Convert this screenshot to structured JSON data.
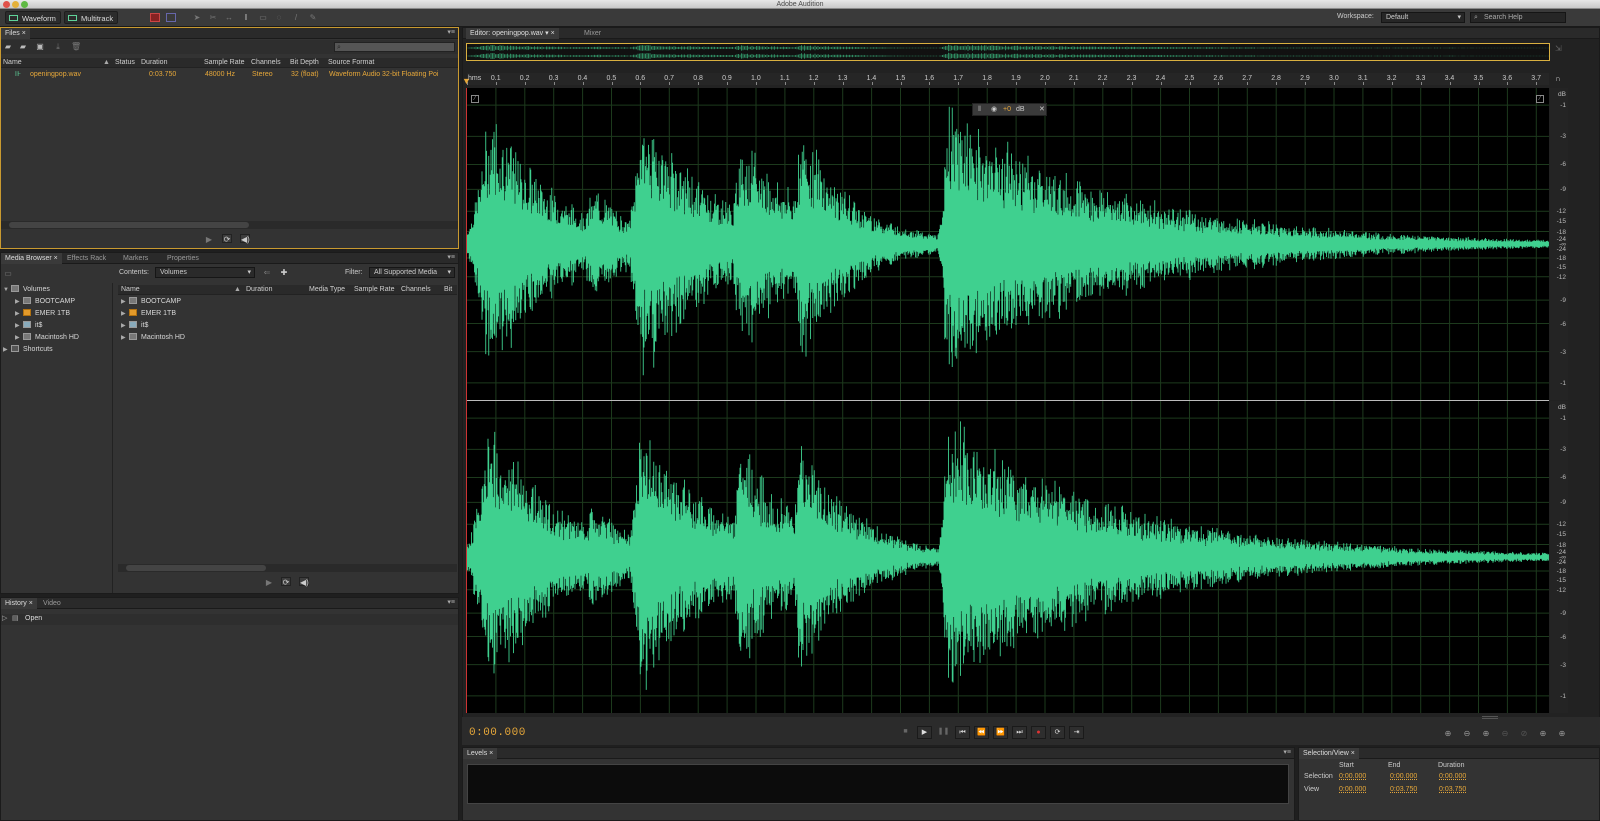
{
  "app": {
    "title": "Adobe Audition"
  },
  "toolbar": {
    "waveform_label": "Waveform",
    "multitrack_label": "Multitrack",
    "workspace_label": "Workspace:",
    "workspace_value": "Default",
    "search_placeholder": "Search Help"
  },
  "files_panel": {
    "tab": "Files",
    "columns": [
      "Name",
      "Status",
      "Duration",
      "Sample Rate",
      "Channels",
      "Bit Depth",
      "Source Format"
    ],
    "rows": [
      {
        "name": "openingpop.wav",
        "status": "",
        "duration": "0:03.750",
        "sample_rate": "48000 Hz",
        "channels": "Stereo",
        "bit_depth": "32 (float)",
        "source_format": "Waveform Audio 32-bit Floating Poi"
      }
    ]
  },
  "media_browser": {
    "tabs": [
      "Media Browser",
      "Effects Rack",
      "Markers",
      "Properties"
    ],
    "contents_label": "Contents:",
    "contents_value": "Volumes",
    "filter_label": "Filter:",
    "filter_value": "All Supported Media",
    "tree": {
      "root": "Volumes",
      "items": [
        "BOOTCAMP",
        "EMER 1TB",
        "it$",
        "Macintosh HD"
      ],
      "shortcuts": "Shortcuts"
    },
    "columns": [
      "Name",
      "Duration",
      "Media Type",
      "Sample Rate",
      "Channels",
      "Bit"
    ],
    "list": [
      "BOOTCAMP",
      "EMER 1TB",
      "it$",
      "Macintosh HD"
    ]
  },
  "history_panel": {
    "tabs": [
      "History",
      "Video"
    ],
    "items": [
      "Open"
    ]
  },
  "editor": {
    "tabs": [
      "Editor: openingpop.wav",
      "Mixer"
    ],
    "ruler": [
      "hms",
      "0.1",
      "0.2",
      "0.3",
      "0.4",
      "0.5",
      "0.6",
      "0.7",
      "0.8",
      "0.9",
      "1.0",
      "1.1",
      "1.2",
      "1.3",
      "1.4",
      "1.5",
      "1.6",
      "1.7",
      "1.8",
      "1.9",
      "2.0",
      "2.1",
      "2.2",
      "2.3",
      "2.4",
      "2.5",
      "2.6",
      "2.7",
      "2.8",
      "2.9",
      "3.0",
      "3.1",
      "3.2",
      "3.3",
      "3.4",
      "3.5",
      "3.6",
      "3.7"
    ],
    "db_scale": [
      "dB",
      "-1",
      "-3",
      "-6",
      "-9",
      "-12",
      "-15",
      "-18",
      "-24",
      "-∞",
      "-24",
      "-18",
      "-15",
      "-12",
      "-9",
      "-6",
      "-3",
      "-1"
    ],
    "hud_value": "+0",
    "hud_unit": "dB",
    "time": "0:00.000",
    "wave_color": "#3fd08f"
  },
  "levels_panel": {
    "tab": "Levels"
  },
  "selection_view": {
    "tab": "Selection/View",
    "headers": [
      "Start",
      "End",
      "Duration"
    ],
    "rows": [
      {
        "label": "Selection",
        "start": "0:00.000",
        "end": "0:00.000",
        "duration": "0:00.000"
      },
      {
        "label": "View",
        "start": "0:00.000",
        "end": "0:03.750",
        "duration": "0:03.750"
      }
    ]
  }
}
